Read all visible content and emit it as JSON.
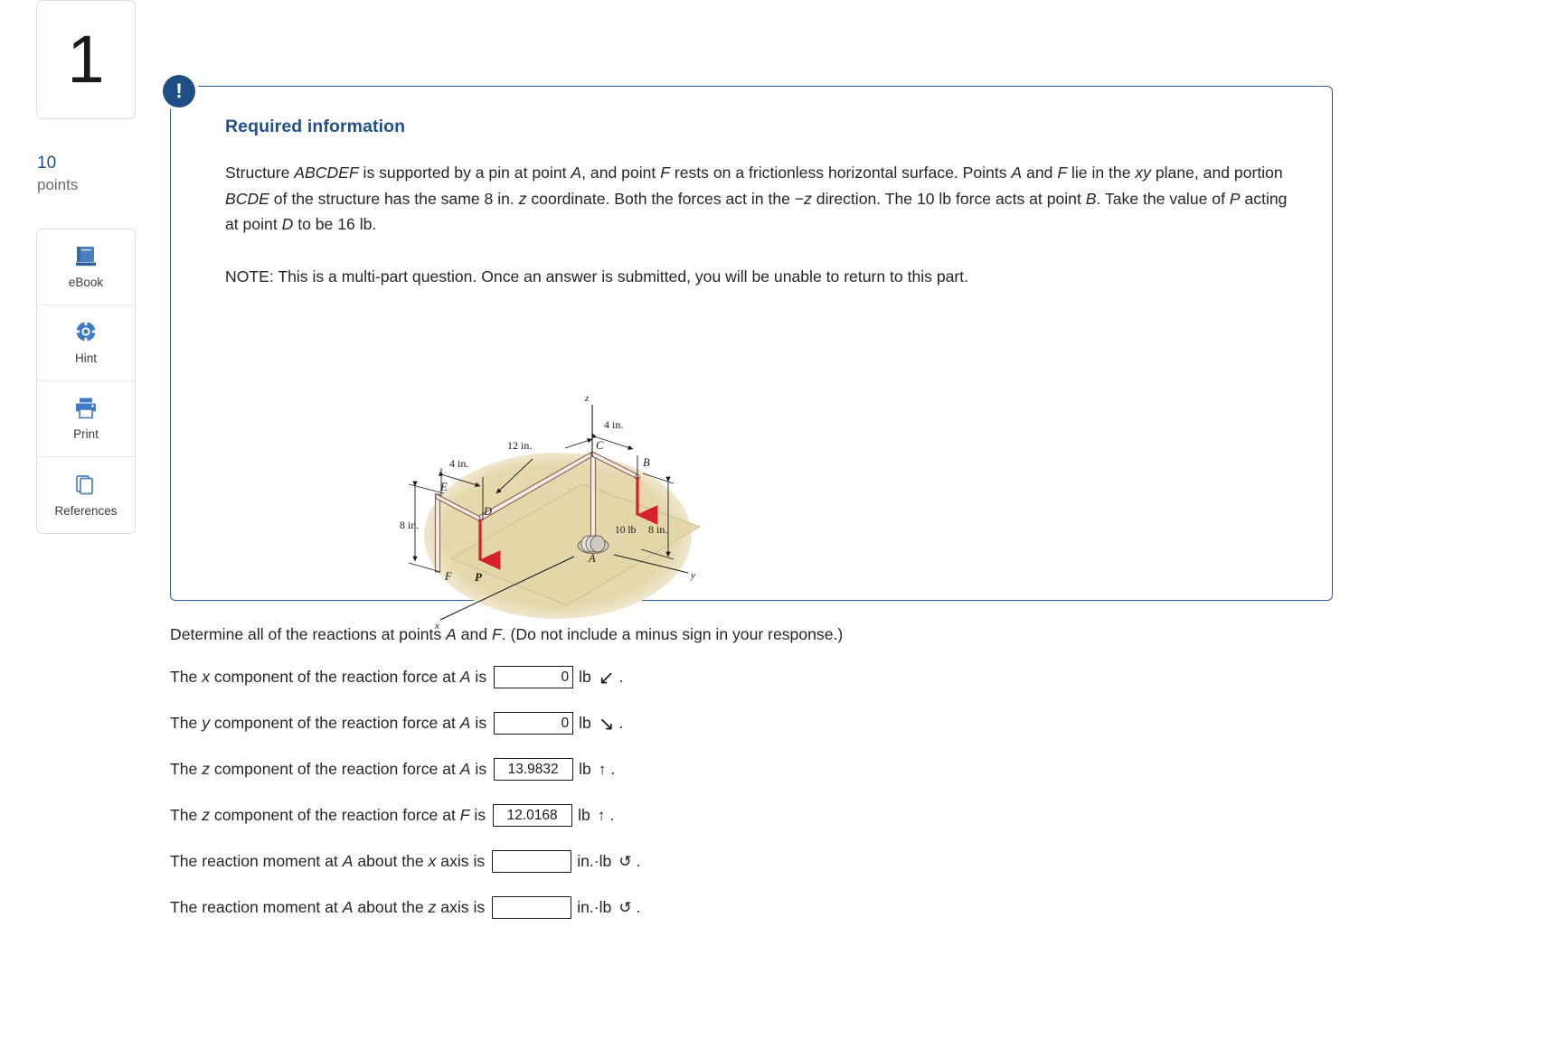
{
  "left_rail": {
    "question_number": "1",
    "points_value": "10",
    "points_label": "points",
    "tools": [
      {
        "label": "eBook",
        "icon": "book-icon"
      },
      {
        "label": "Hint",
        "icon": "lifesaver-icon"
      },
      {
        "label": "Print",
        "icon": "printer-icon"
      },
      {
        "label": "References",
        "icon": "copy-pages-icon"
      }
    ]
  },
  "info_panel": {
    "badge": "!",
    "title": "Required information",
    "paragraph": "Structure ABCDEF is supported by a pin at point A, and point F rests on a frictionless horizontal surface. Points A and F lie in the xy plane, and portion BCDE of the structure has the same 8 in. z coordinate. Both the forces act in the −z direction. The 10 lb force acts at point B. Take the value of P acting at point D to be 16 lb.",
    "note": "NOTE: This is a multi-part question. Once an answer is submitted, you will be unable to return to this part."
  },
  "figure": {
    "axis_z": "z",
    "axis_y": "y",
    "axis_x": "x",
    "point_labels": [
      "A",
      "B",
      "C",
      "D",
      "E",
      "F"
    ],
    "load_P": "P",
    "load_10lb": "10 lb",
    "dim_4in_top": "4 in.",
    "dim_12in": "12 in.",
    "dim_4in_left": "4 in.",
    "dim_8in_left": "8 in.",
    "dim_8in_right": "8 in.",
    "colors": {
      "ground": "#e3d6a9",
      "ground_light": "#efe7c9",
      "member_fill": "#f7e8e0",
      "member_stroke": "#8a6a5c",
      "force_arrow": "#d6202a"
    }
  },
  "question": {
    "prompt": "Determine all of the reactions at points A and F. (Do not include a minus sign in your response.)",
    "answers": [
      {
        "lead_1": "The ",
        "var": "x",
        "lead_2": " component of the reaction force at ",
        "point": "A",
        "lead_3": " is",
        "value": "0",
        "unit": "lb",
        "direction_icon": "arrow-down-left",
        "direction_glyph": "↙",
        "trailing": "."
      },
      {
        "lead_1": "The ",
        "var": "y",
        "lead_2": " component of the reaction force at ",
        "point": "A",
        "lead_3": " is",
        "value": "0",
        "unit": "lb",
        "direction_icon": "arrow-down-right",
        "direction_glyph": "↘",
        "trailing": "."
      },
      {
        "lead_1": "The ",
        "var": "z",
        "lead_2": " component of the reaction force at ",
        "point": "A",
        "lead_3": " is",
        "value": "13.9832",
        "unit": "lb",
        "direction_icon": "arrow-up",
        "direction_glyph": "↑",
        "trailing": "."
      },
      {
        "lead_1": "The ",
        "var": "z",
        "lead_2": " component of the reaction force at ",
        "point": "F",
        "lead_3": " is",
        "value": "12.0168",
        "unit": "lb",
        "direction_icon": "arrow-up",
        "direction_glyph": "↑",
        "trailing": "."
      },
      {
        "lead_1": "The reaction moment at ",
        "var": "",
        "lead_2": "",
        "point": "A",
        "lead_3": " about the x axis is",
        "value": "",
        "unit": "in.·lb",
        "direction_icon": "rotate-ccw",
        "direction_glyph": "↺",
        "trailing": "."
      },
      {
        "lead_1": "The reaction moment at ",
        "var": "",
        "lead_2": "",
        "point": "A",
        "lead_3": " about the z axis is",
        "value": "",
        "unit": "in.·lb",
        "direction_icon": "rotate-ccw",
        "direction_glyph": "↺",
        "trailing": "."
      }
    ]
  },
  "colors": {
    "accent": "#1f4e87",
    "panel_border": "#2d5b96",
    "heading": "#22508f",
    "icon_blue": "#3f7ac4"
  }
}
